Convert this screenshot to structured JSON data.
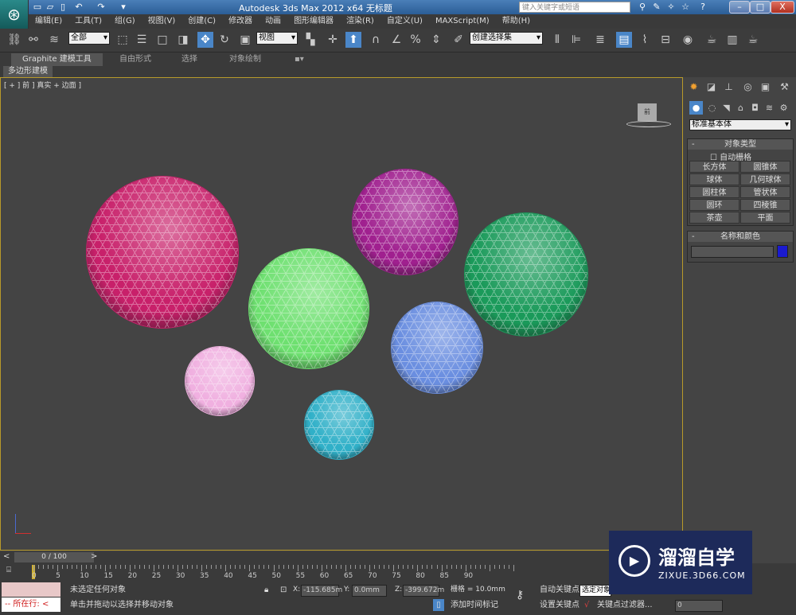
{
  "titlebar": {
    "title": "Autodesk 3ds Max  2012 x64     无标题",
    "search_placeholder": "键入关键字或短语",
    "quick_access": [
      "new-icon",
      "open-icon",
      "save-icon",
      "undo-icon",
      "redo-icon",
      "dropdown-icon"
    ],
    "window_buttons": [
      "–",
      "□",
      "X"
    ]
  },
  "menu": [
    "编辑(E)",
    "工具(T)",
    "组(G)",
    "视图(V)",
    "创建(C)",
    "修改器",
    "动画",
    "图形编辑器",
    "渲染(R)",
    "自定义(U)",
    "MAXScript(M)",
    "帮助(H)"
  ],
  "toolbar": {
    "selection_filter": "全部",
    "reference_coord": "视图",
    "named_selection": "创建选择集"
  },
  "ribbon": {
    "tabs": [
      "Graphite 建模工具",
      "自由形式",
      "选择",
      "对象绘制"
    ],
    "subtab": "多边形建模"
  },
  "viewport": {
    "label": "[ + ] 前 ] 真实 + 边面 ]",
    "viewcube_label": "前",
    "objects": [
      {
        "type": "sphere",
        "color": "#c8206a"
      },
      {
        "type": "sphere",
        "color": "#a0208f"
      },
      {
        "type": "sphere",
        "color": "#1a9a5a"
      },
      {
        "type": "sphere",
        "color": "#6ee070"
      },
      {
        "type": "sphere",
        "color": "#6a8ee0"
      },
      {
        "type": "sphere",
        "color": "#f0b0e0"
      },
      {
        "type": "sphere",
        "color": "#30b0c8"
      }
    ]
  },
  "panel": {
    "primitive_type": "标准基本体",
    "object_type_header": "对象类型",
    "autogrid": "自动栅格",
    "buttons": [
      "长方体",
      "圆锥体",
      "球体",
      "几何球体",
      "圆柱体",
      "管状体",
      "圆环",
      "四棱锥",
      "茶壶",
      "平面"
    ],
    "name_color_header": "名称和颜色",
    "object_color": "#1a1ad0"
  },
  "timeline": {
    "position": "0 / 100",
    "ticks": [
      "0",
      "5",
      "10",
      "15",
      "20",
      "25",
      "30",
      "35",
      "40",
      "45",
      "50",
      "55",
      "60",
      "65",
      "70",
      "75",
      "80",
      "85",
      "90"
    ]
  },
  "status": {
    "maxscript": "所在行:",
    "selection": "未选定任何对象",
    "prompt": "单击并拖动以选择并移动对象",
    "x": "-115.685m",
    "y": "0.0mm",
    "z": "-399.672m",
    "x_label": "X:",
    "y_label": "Y:",
    "z_label": "Z:",
    "grid": "栅格 = 10.0mm",
    "add_time_tag": "添加时间标记",
    "auto_key": "自动关键点",
    "set_key": "设置关键点",
    "selected": "选定对象",
    "key_filters": "关键点过滤器...",
    "frame": "0"
  },
  "watermark": {
    "brand": "溜溜自学",
    "url": "ZIXUE.3D66.COM"
  }
}
